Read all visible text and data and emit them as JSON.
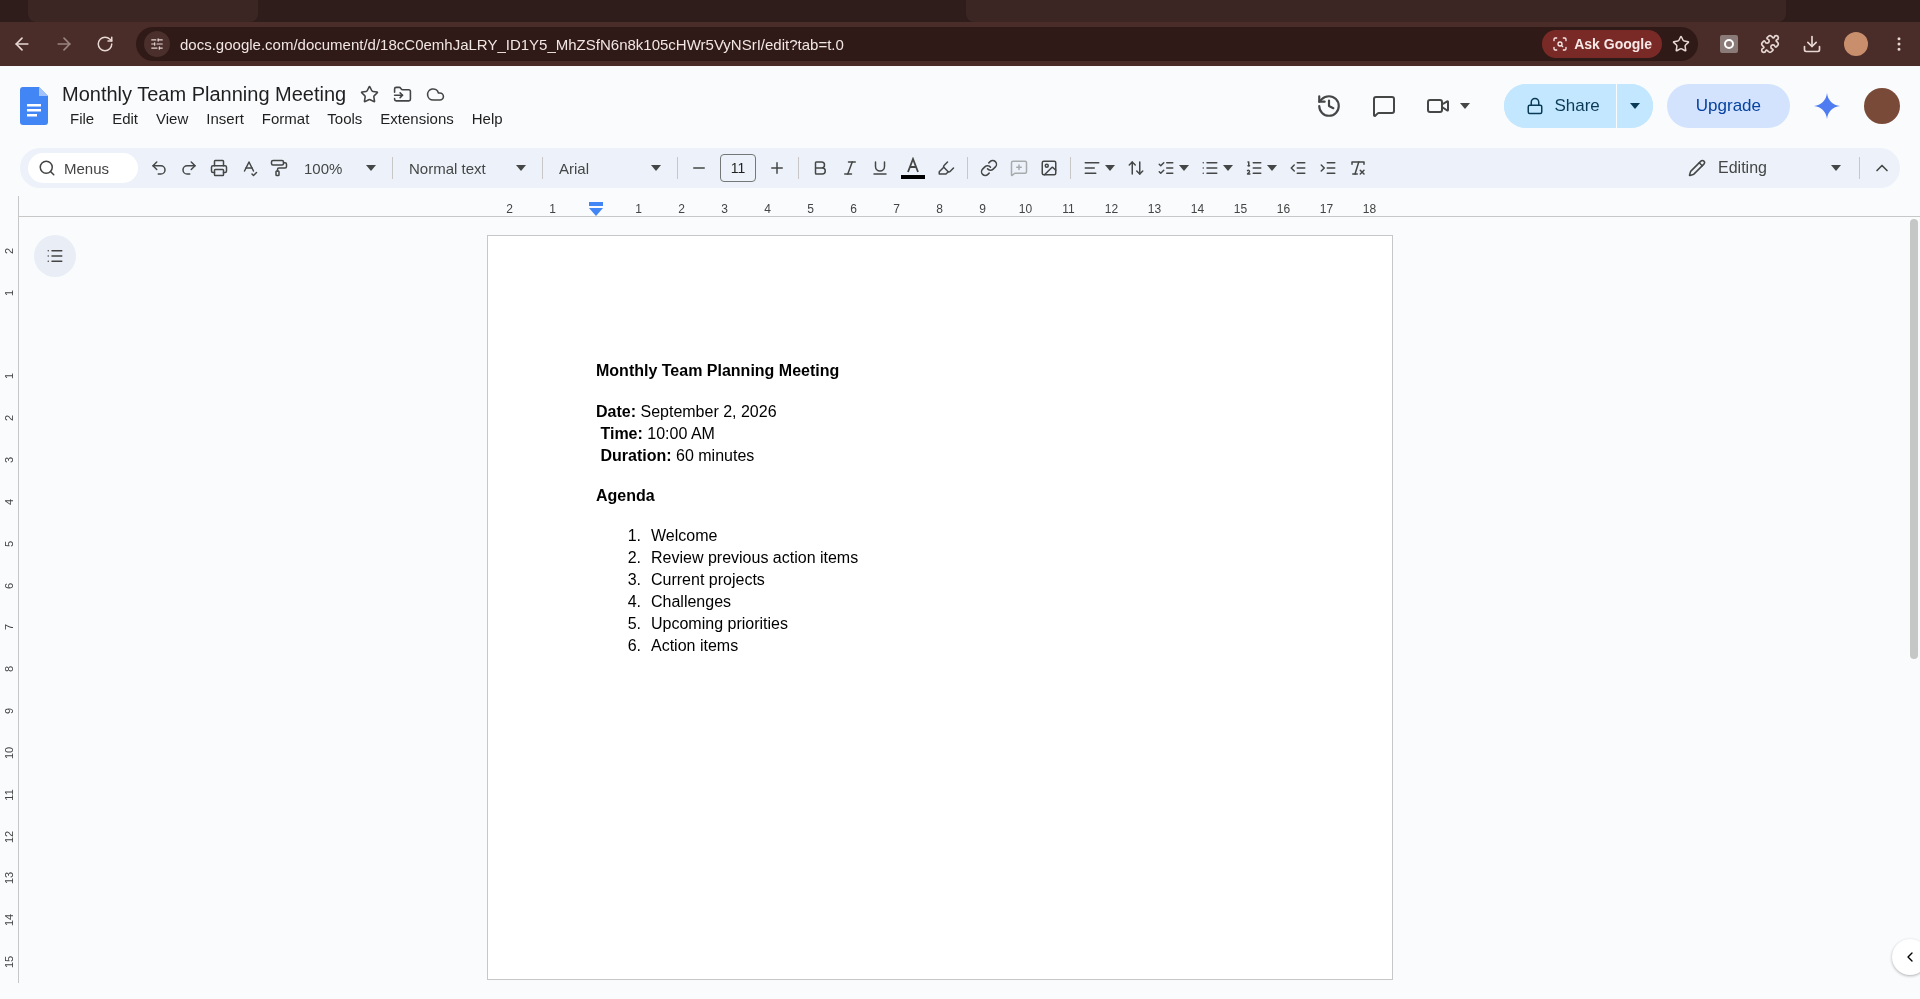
{
  "browser": {
    "address": "docs.google.com/document/d/18cC0emhJaLRY_ID1Y5_MhZSfN6n8k105cHWr5VyNSrI/edit?tab=t.0",
    "ask_google": "Ask Google"
  },
  "header": {
    "title": "Monthly Team Planning Meeting",
    "menus": [
      "File",
      "Edit",
      "View",
      "Insert",
      "Format",
      "Tools",
      "Extensions",
      "Help"
    ],
    "share": "Share",
    "upgrade": "Upgrade"
  },
  "toolbar": {
    "search_placeholder": "Menus",
    "zoom": "100%",
    "style": "Normal text",
    "font": "Arial",
    "font_size": "11",
    "mode": "Editing"
  },
  "rulers": {
    "left_labels": [
      "2",
      "1"
    ],
    "right_labels": [
      "1",
      "2",
      "3",
      "4",
      "5",
      "6",
      "7",
      "8",
      "9",
      "10",
      "11",
      "12",
      "13",
      "14",
      "15",
      "16",
      "17",
      "18"
    ],
    "top_labels": [
      "2",
      "1"
    ],
    "body_labels": [
      "1",
      "2",
      "3",
      "4",
      "5",
      "6",
      "7",
      "8",
      "9",
      "10",
      "11",
      "12",
      "13",
      "14",
      "15"
    ]
  },
  "document": {
    "title": "Monthly Team Planning Meeting",
    "details": [
      "**Date:** September 2, 2026",
      " **Time:** 10:00 AM",
      " **Duration:** 60 minutes"
    ],
    "agenda_heading": "Agenda",
    "agenda": [
      {
        "number": "1.",
        "text": "Welcome"
      },
      {
        "number": "2.",
        "text": "Review previous action items"
      },
      {
        "number": "3.",
        "text": "Current projects"
      },
      {
        "number": "4.",
        "text": "Challenges"
      },
      {
        "number": "5.",
        "text": "Upcoming priorities"
      },
      {
        "number": "6.",
        "text": "Action items"
      }
    ]
  }
}
